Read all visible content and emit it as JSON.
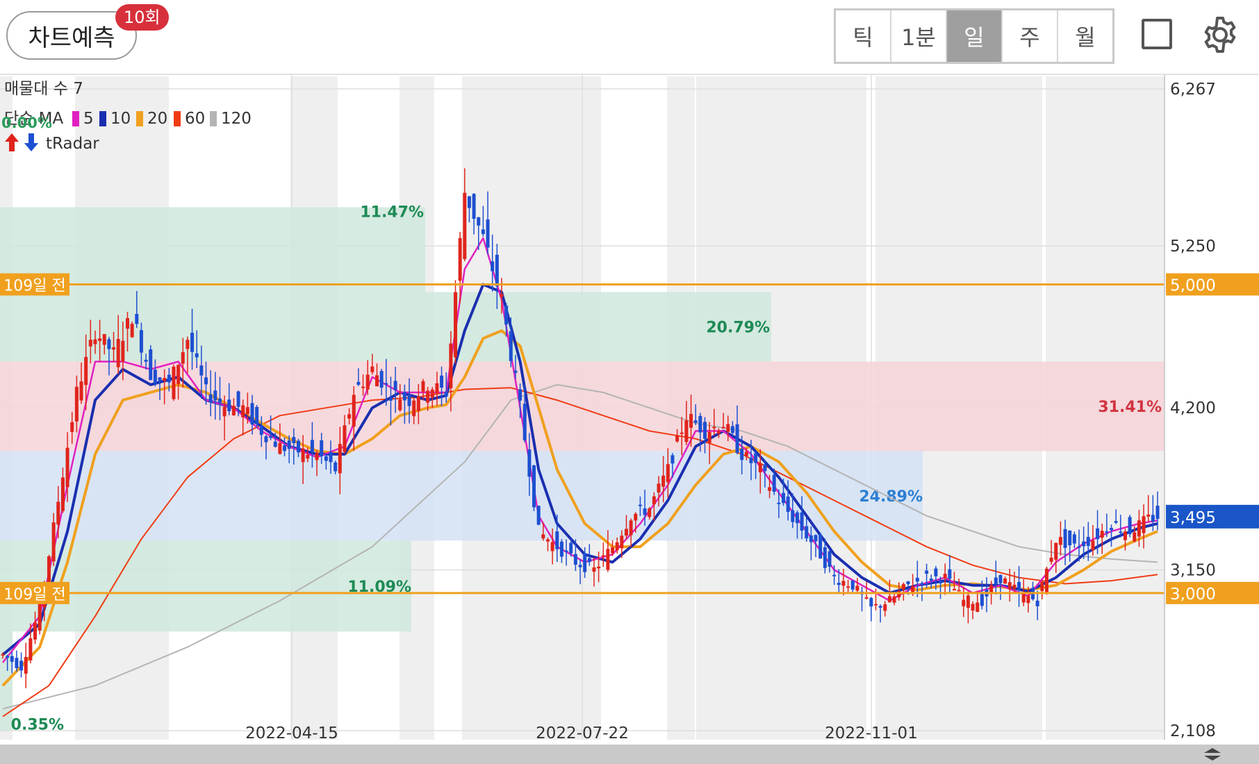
{
  "header": {
    "predict_label": "차트예측",
    "predict_count": "10회",
    "periods": [
      "틱",
      "1분",
      "일",
      "주",
      "월"
    ],
    "active_period": "일"
  },
  "legend": {
    "volume_profile": "매물대 수 7",
    "ma_label": "단순 MA",
    "ma": [
      {
        "label": "5",
        "color": "#e020c0"
      },
      {
        "label": "10",
        "color": "#1a2fb0"
      },
      {
        "label": "20",
        "color": "#f0a01e"
      },
      {
        "label": "60",
        "color": "#f03c14"
      },
      {
        "label": "120",
        "color": "#b4b4b4"
      }
    ],
    "radar_label": "tRadar",
    "top_pct": "0.00%"
  },
  "colors": {
    "up": "#e0241c",
    "down": "#1d4fd1",
    "ma5": "#e020c0",
    "ma10": "#1a2fb0",
    "ma20": "#f0a01e",
    "ma60": "#f03c14",
    "ma120": "#b4b4b4",
    "level_line": "#f0a01e",
    "current_price": "#1a56c8"
  },
  "chart_data": {
    "type": "candlestick",
    "y_axis": {
      "ticks": [
        "6,267",
        "5,250",
        "4,200",
        "3,150",
        "2,108"
      ],
      "min": 2108,
      "max": 6267
    },
    "x_axis": {
      "ticks": [
        "2022-04-15",
        "2022-07-22",
        "2022-11-01"
      ]
    },
    "levels": [
      {
        "price": 5000,
        "value_label": "5,000",
        "tag": "109일 전"
      },
      {
        "price": 3000,
        "value_label": "3,000",
        "tag": "109일 전"
      }
    ],
    "current_price": {
      "value": 3495,
      "label": "3,495"
    },
    "volume_profile": [
      {
        "price_low": 4950,
        "price_high": 5500,
        "label": "11.47%",
        "color": "green"
      },
      {
        "price_low": 4500,
        "price_high": 4950,
        "label": "20.79%",
        "color": "green"
      },
      {
        "price_low": 3920,
        "price_high": 4500,
        "label": "31.41%",
        "color": "red"
      },
      {
        "price_low": 3340,
        "price_high": 3920,
        "label": "24.89%",
        "color": "blue"
      },
      {
        "price_low": 2750,
        "price_high": 3340,
        "label": "11.09%",
        "color": "green"
      },
      {
        "price_low": 2108,
        "price_high": 2750,
        "label": "0.35%",
        "color": "green"
      }
    ],
    "close_path": [
      [
        0,
        2600
      ],
      [
        4,
        2520
      ],
      [
        8,
        2900
      ],
      [
        12,
        3600
      ],
      [
        16,
        4300
      ],
      [
        20,
        4700
      ],
      [
        24,
        4550
      ],
      [
        28,
        4800
      ],
      [
        32,
        4420
      ],
      [
        36,
        4350
      ],
      [
        40,
        4650
      ],
      [
        44,
        4300
      ],
      [
        48,
        4220
      ],
      [
        52,
        4200
      ],
      [
        56,
        4050
      ],
      [
        60,
        3950
      ],
      [
        64,
        3920
      ],
      [
        68,
        3900
      ],
      [
        72,
        3800
      ],
      [
        76,
        4300
      ],
      [
        80,
        4450
      ],
      [
        84,
        4300
      ],
      [
        88,
        4250
      ],
      [
        92,
        4350
      ],
      [
        96,
        4300
      ],
      [
        100,
        5600
      ],
      [
        104,
        5300
      ],
      [
        108,
        4900
      ],
      [
        112,
        4200
      ],
      [
        116,
        3400
      ],
      [
        120,
        3300
      ],
      [
        124,
        3200
      ],
      [
        128,
        3150
      ],
      [
        132,
        3300
      ],
      [
        136,
        3500
      ],
      [
        140,
        3550
      ],
      [
        144,
        3800
      ],
      [
        148,
        4150
      ],
      [
        152,
        4050
      ],
      [
        156,
        4100
      ],
      [
        160,
        3900
      ],
      [
        164,
        3800
      ],
      [
        168,
        3600
      ],
      [
        172,
        3450
      ],
      [
        176,
        3300
      ],
      [
        180,
        3100
      ],
      [
        184,
        3050
      ],
      [
        188,
        2900
      ],
      [
        192,
        2950
      ],
      [
        196,
        3050
      ],
      [
        200,
        3100
      ],
      [
        204,
        3100
      ],
      [
        208,
        2950
      ],
      [
        212,
        2950
      ],
      [
        216,
        3100
      ],
      [
        220,
        3000
      ],
      [
        224,
        2950
      ],
      [
        228,
        3350
      ],
      [
        232,
        3300
      ],
      [
        236,
        3350
      ],
      [
        240,
        3450
      ],
      [
        244,
        3400
      ],
      [
        248,
        3480
      ],
      [
        250,
        3495
      ]
    ],
    "ma5": [
      [
        0,
        2550
      ],
      [
        8,
        2850
      ],
      [
        14,
        3700
      ],
      [
        20,
        4500
      ],
      [
        26,
        4500
      ],
      [
        32,
        4450
      ],
      [
        38,
        4500
      ],
      [
        44,
        4250
      ],
      [
        50,
        4200
      ],
      [
        56,
        4050
      ],
      [
        62,
        3950
      ],
      [
        68,
        3880
      ],
      [
        74,
        3950
      ],
      [
        80,
        4400
      ],
      [
        86,
        4300
      ],
      [
        92,
        4300
      ],
      [
        96,
        4300
      ],
      [
        100,
        5100
      ],
      [
        104,
        5300
      ],
      [
        108,
        4900
      ],
      [
        112,
        4200
      ],
      [
        116,
        3500
      ],
      [
        120,
        3300
      ],
      [
        126,
        3200
      ],
      [
        132,
        3250
      ],
      [
        138,
        3450
      ],
      [
        144,
        3700
      ],
      [
        150,
        4050
      ],
      [
        156,
        4050
      ],
      [
        162,
        3900
      ],
      [
        168,
        3650
      ],
      [
        174,
        3400
      ],
      [
        180,
        3150
      ],
      [
        186,
        3050
      ],
      [
        192,
        2950
      ],
      [
        198,
        3050
      ],
      [
        204,
        3100
      ],
      [
        210,
        3000
      ],
      [
        216,
        3050
      ],
      [
        222,
        2980
      ],
      [
        228,
        3200
      ],
      [
        234,
        3320
      ],
      [
        240,
        3400
      ],
      [
        246,
        3450
      ],
      [
        250,
        3470
      ]
    ],
    "ma10": [
      [
        0,
        2600
      ],
      [
        8,
        2800
      ],
      [
        14,
        3400
      ],
      [
        20,
        4250
      ],
      [
        26,
        4450
      ],
      [
        32,
        4350
      ],
      [
        38,
        4400
      ],
      [
        44,
        4250
      ],
      [
        50,
        4200
      ],
      [
        56,
        4080
      ],
      [
        62,
        3950
      ],
      [
        68,
        3900
      ],
      [
        74,
        3900
      ],
      [
        80,
        4200
      ],
      [
        86,
        4300
      ],
      [
        92,
        4250
      ],
      [
        96,
        4280
      ],
      [
        100,
        4700
      ],
      [
        104,
        5000
      ],
      [
        108,
        4950
      ],
      [
        112,
        4500
      ],
      [
        116,
        3800
      ],
      [
        120,
        3450
      ],
      [
        126,
        3250
      ],
      [
        132,
        3200
      ],
      [
        138,
        3350
      ],
      [
        144,
        3600
      ],
      [
        150,
        3950
      ],
      [
        156,
        4050
      ],
      [
        162,
        3950
      ],
      [
        168,
        3750
      ],
      [
        174,
        3500
      ],
      [
        180,
        3250
      ],
      [
        186,
        3100
      ],
      [
        192,
        3000
      ],
      [
        198,
        3050
      ],
      [
        204,
        3080
      ],
      [
        210,
        3050
      ],
      [
        216,
        3050
      ],
      [
        222,
        3010
      ],
      [
        228,
        3100
      ],
      [
        234,
        3250
      ],
      [
        240,
        3350
      ],
      [
        246,
        3420
      ],
      [
        250,
        3450
      ]
    ],
    "ma20": [
      [
        0,
        2400
      ],
      [
        8,
        2650
      ],
      [
        14,
        3200
      ],
      [
        20,
        3900
      ],
      [
        26,
        4250
      ],
      [
        32,
        4300
      ],
      [
        38,
        4350
      ],
      [
        44,
        4300
      ],
      [
        50,
        4200
      ],
      [
        56,
        4100
      ],
      [
        62,
        4000
      ],
      [
        68,
        3920
      ],
      [
        74,
        3900
      ],
      [
        80,
        4000
      ],
      [
        86,
        4150
      ],
      [
        92,
        4200
      ],
      [
        96,
        4220
      ],
      [
        100,
        4400
      ],
      [
        104,
        4650
      ],
      [
        108,
        4700
      ],
      [
        112,
        4600
      ],
      [
        116,
        4200
      ],
      [
        120,
        3800
      ],
      [
        126,
        3450
      ],
      [
        132,
        3300
      ],
      [
        138,
        3300
      ],
      [
        144,
        3450
      ],
      [
        150,
        3700
      ],
      [
        156,
        3900
      ],
      [
        162,
        3950
      ],
      [
        168,
        3850
      ],
      [
        174,
        3650
      ],
      [
        180,
        3400
      ],
      [
        186,
        3200
      ],
      [
        192,
        3050
      ],
      [
        198,
        3020
      ],
      [
        204,
        3050
      ],
      [
        210,
        3060
      ],
      [
        216,
        3040
      ],
      [
        222,
        3020
      ],
      [
        228,
        3050
      ],
      [
        234,
        3150
      ],
      [
        240,
        3270
      ],
      [
        246,
        3350
      ],
      [
        250,
        3400
      ]
    ],
    "ma60": [
      [
        0,
        2200
      ],
      [
        10,
        2400
      ],
      [
        20,
        2850
      ],
      [
        30,
        3350
      ],
      [
        40,
        3750
      ],
      [
        50,
        4000
      ],
      [
        60,
        4150
      ],
      [
        70,
        4200
      ],
      [
        80,
        4250
      ],
      [
        90,
        4270
      ],
      [
        100,
        4320
      ],
      [
        110,
        4330
      ],
      [
        120,
        4250
      ],
      [
        130,
        4150
      ],
      [
        140,
        4050
      ],
      [
        150,
        4000
      ],
      [
        160,
        3900
      ],
      [
        170,
        3750
      ],
      [
        180,
        3600
      ],
      [
        190,
        3450
      ],
      [
        200,
        3300
      ],
      [
        210,
        3180
      ],
      [
        220,
        3100
      ],
      [
        230,
        3060
      ],
      [
        240,
        3080
      ],
      [
        250,
        3120
      ]
    ],
    "ma120": [
      [
        0,
        2250
      ],
      [
        20,
        2400
      ],
      [
        40,
        2650
      ],
      [
        60,
        2950
      ],
      [
        80,
        3300
      ],
      [
        100,
        3850
      ],
      [
        110,
        4250
      ],
      [
        120,
        4350
      ],
      [
        130,
        4300
      ],
      [
        140,
        4200
      ],
      [
        150,
        4100
      ],
      [
        160,
        4050
      ],
      [
        170,
        3950
      ],
      [
        180,
        3800
      ],
      [
        190,
        3650
      ],
      [
        200,
        3500
      ],
      [
        210,
        3400
      ],
      [
        220,
        3300
      ],
      [
        230,
        3250
      ],
      [
        240,
        3220
      ],
      [
        250,
        3200
      ]
    ]
  }
}
